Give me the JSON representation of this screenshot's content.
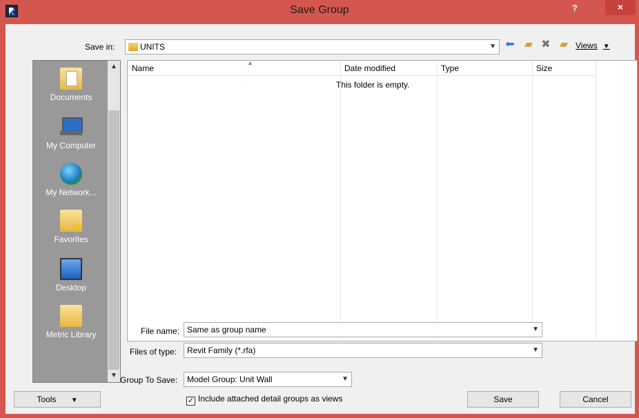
{
  "window": {
    "title": "Save Group",
    "help": "?",
    "close": "×"
  },
  "save_in": {
    "label": "Save in:",
    "value": "UNITS"
  },
  "toolbar": {
    "views_label": "Views"
  },
  "places": [
    {
      "label": "Documents",
      "icon": "documents-icon"
    },
    {
      "label": "My Computer",
      "icon": "my-computer-icon"
    },
    {
      "label": "My Network...",
      "icon": "my-network-icon"
    },
    {
      "label": "Favorites",
      "icon": "favorites-icon"
    },
    {
      "label": "Desktop",
      "icon": "desktop-icon"
    },
    {
      "label": "Metric Library",
      "icon": "metric-library-icon"
    }
  ],
  "file_list": {
    "columns": [
      "Name",
      "Date modified",
      "Type",
      "Size"
    ],
    "empty_message": "This folder is empty."
  },
  "file_name": {
    "label": "File name:",
    "value": "Same as group name"
  },
  "files_of_type": {
    "label": "Files of type:",
    "value": "Revit Family  (*.rfa)"
  },
  "group_to_save": {
    "label": "Group To Save:",
    "value": "Model Group: Unit Wall"
  },
  "include_detail": {
    "label": "Include attached detail groups as views",
    "checked": true
  },
  "buttons": {
    "tools": "Tools",
    "save": "Save",
    "cancel": "Cancel"
  }
}
